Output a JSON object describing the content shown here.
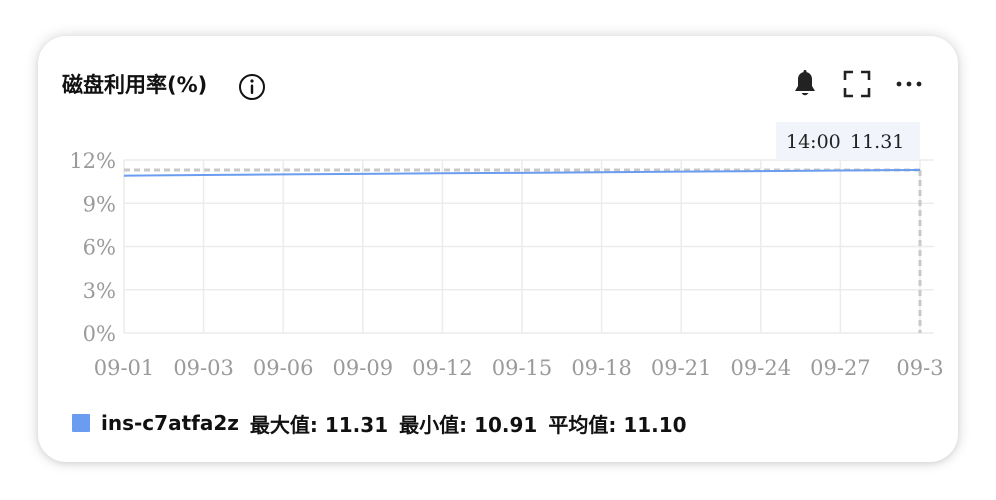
{
  "header": {
    "title": "磁盘利用率(%)",
    "info_icon": "info-icon",
    "actions": [
      "bell-icon",
      "fullscreen-icon",
      "more-icon"
    ]
  },
  "colors": {
    "series": "#6a9cf0",
    "grid": "#ececec",
    "reference_line": "#c8c8c8",
    "tick_label": "#9a9a9a",
    "tooltip_bg": "#f1f4fa"
  },
  "chart_data": {
    "type": "line",
    "x": [
      "09-01",
      "09-03",
      "09-06",
      "09-09",
      "09-12",
      "09-15",
      "09-18",
      "09-21",
      "09-24",
      "09-27",
      "09-3"
    ],
    "yticks": [
      "0%",
      "3%",
      "6%",
      "9%",
      "12%"
    ],
    "ylim": [
      0,
      12
    ],
    "grid": true,
    "series": [
      {
        "name": "ins-c7atfa2z",
        "values": [
          10.91,
          10.96,
          11.0,
          11.04,
          11.08,
          11.11,
          11.15,
          11.19,
          11.23,
          11.27,
          11.31
        ]
      }
    ],
    "reference_line": 11.31,
    "tooltip": {
      "time": "14:00",
      "value": "11.31"
    }
  },
  "legend": {
    "series_name": "ins-c7atfa2z",
    "max": "最大值: 11.31",
    "min": "最小值: 10.91",
    "avg": "平均值: 11.10"
  }
}
